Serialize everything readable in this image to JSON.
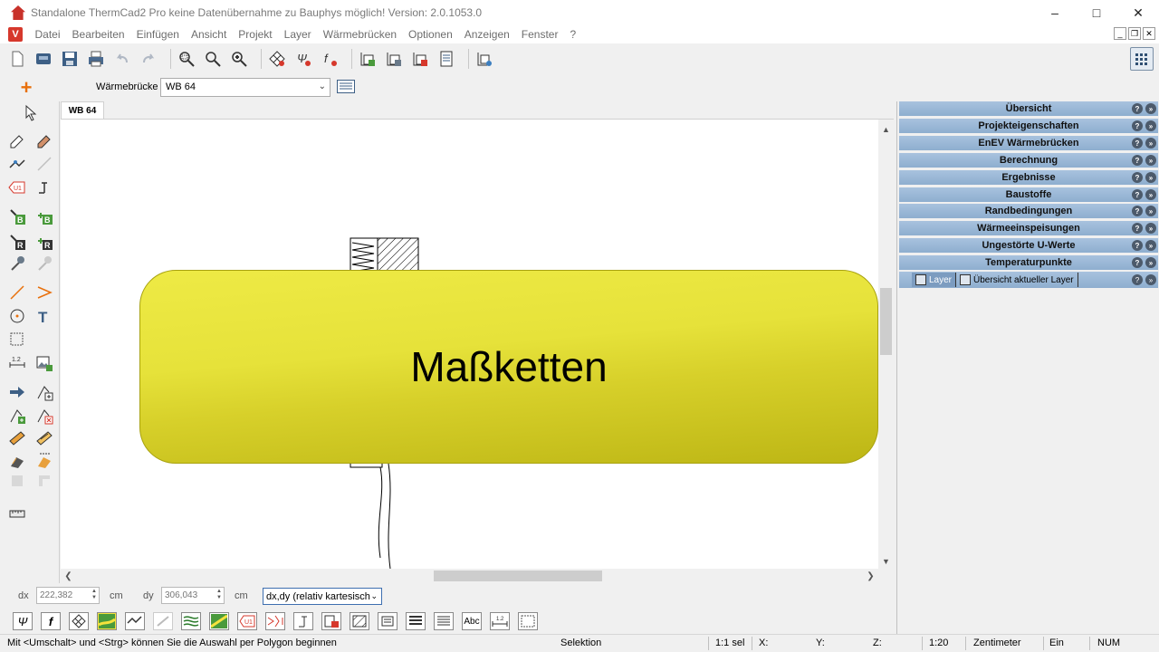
{
  "window": {
    "title": "Standalone ThermCad2 Pro  keine Datenübernahme zu Bauphys möglich! Version: 2.0.1053.0",
    "app_logo_letter": "V"
  },
  "menu": [
    "Datei",
    "Bearbeiten",
    "Einfügen",
    "Ansicht",
    "Projekt",
    "Layer",
    "Wärmebrücken",
    "Optionen",
    "Anzeigen",
    "Fenster",
    "?"
  ],
  "selector": {
    "label": "Wärmebrücke :",
    "value": "WB 64"
  },
  "document_tab": "WB 64",
  "overlay": {
    "text": "Maßketten",
    "color": "#e6e23a"
  },
  "right_panel": {
    "sections": [
      "Übersicht",
      "Projekteigenschaften",
      "EnEV Wärmebrücken",
      "Berechnung",
      "Ergebnisse",
      "Baustoffe",
      "Randbedingungen",
      "Wärmeeinspeisungen",
      "Ungestörte U-Werte",
      "Temperaturpunkte"
    ],
    "layer_tabs": [
      "Layer",
      "Übersicht aktueller Layer"
    ]
  },
  "coords": {
    "dx_label": "dx",
    "dx_value": "222,382",
    "dx_unit": "cm",
    "dy_label": "dy",
    "dy_value": "306,043",
    "dy_unit": "cm",
    "mode": "dx,dy (relativ kartesisch"
  },
  "status": {
    "message": "Mit <Umschalt> und <Strg> können Sie die Auswahl per Polygon beginnen",
    "mode": "Selektion",
    "selection": "1:1 sel",
    "x_label": "X:",
    "y_label": "Y:",
    "z_label": "Z:",
    "scale": "1:20",
    "unit": "Zentimeter",
    "insert": "Ein",
    "num": "NUM"
  },
  "bottom_toolbar_text": {
    "abc": "Abc",
    "u1": "U1",
    "f": "f",
    "psi": "Ψ"
  },
  "colors": {
    "panel_header": "#9db8d7",
    "accent_orange": "#e8700c",
    "brand_red": "#d6382c"
  }
}
